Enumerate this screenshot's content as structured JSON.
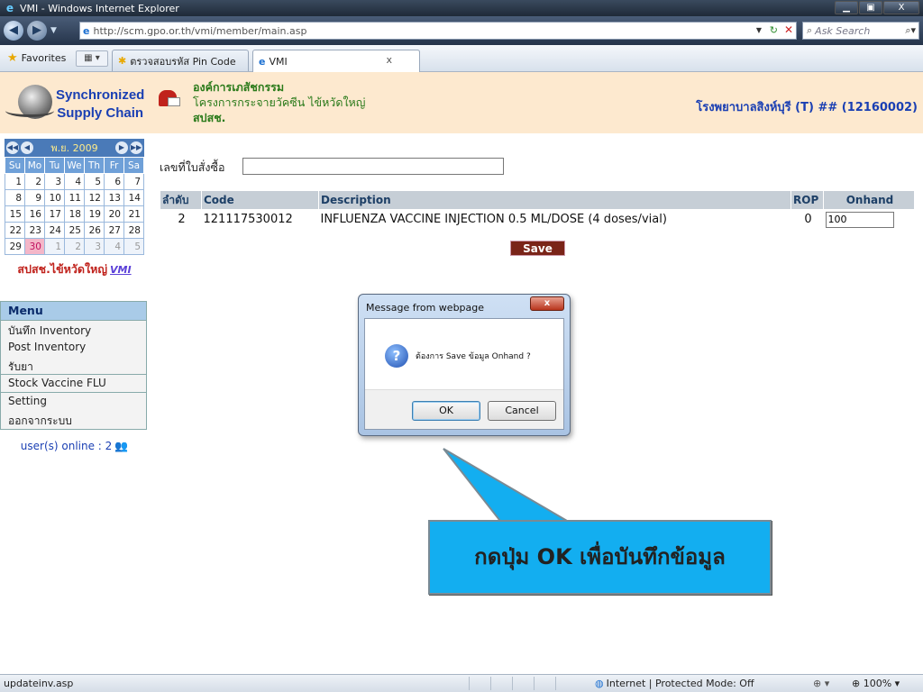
{
  "window": {
    "title": "VMI - Windows Internet Explorer",
    "minimize": "▁",
    "maximize": "▣",
    "close": "X"
  },
  "navbar": {
    "back": "◀",
    "forward": "▶",
    "url": "http://scm.gpo.or.th/vmi/member/main.asp",
    "search_placeholder": "Ask Search"
  },
  "favbar": {
    "favorites_label": "Favorites",
    "tabs": [
      {
        "label": "ตรวจสอบรหัส Pin Code"
      },
      {
        "label": "VMI"
      }
    ]
  },
  "header": {
    "brand_line1": "Synchronized",
    "brand_line2": "Supply Chain",
    "org_line1": "องค์การเภสัชกรรม",
    "org_line2": "โครงการกระจายวัคซีน ไข้หวัดใหญ่",
    "org_line3": "สปสช.",
    "hospital": "โรงพยาบาลสิงห์บุรี (T) ## (12160002)"
  },
  "calendar": {
    "month_label": "พ.ย. 2009",
    "weekdays": [
      "Su",
      "Mo",
      "Tu",
      "We",
      "Th",
      "Fr",
      "Sa"
    ],
    "weeks": [
      [
        1,
        2,
        3,
        4,
        5,
        6,
        7
      ],
      [
        8,
        9,
        10,
        11,
        12,
        13,
        14
      ],
      [
        15,
        16,
        17,
        18,
        19,
        20,
        21
      ],
      [
        22,
        23,
        24,
        25,
        26,
        27,
        28
      ],
      [
        29,
        30,
        1,
        2,
        3,
        4,
        5
      ]
    ],
    "caption": "สปสช.ไข้หวัดใหญ่",
    "caption_logo": "VMI"
  },
  "menu": {
    "title": "Menu",
    "items": [
      {
        "label": "บันทึก Inventory"
      },
      {
        "label": "Post Inventory"
      },
      {
        "label": "รับยา"
      },
      {
        "label": "Stock Vaccine FLU"
      },
      {
        "label": "Setting"
      },
      {
        "label": "ออกจากระบบ"
      }
    ]
  },
  "online": {
    "text": "user(s) online : 2"
  },
  "main": {
    "po_label": "เลขที่ใบสั่งซื้อ",
    "po_value": "",
    "columns": [
      "ลำดับ",
      "Code",
      "Description",
      "ROP",
      "Onhand"
    ],
    "rows": [
      {
        "no": "2",
        "code": "121117530012",
        "description": "INFLUENZA VACCINE INJECTION 0.5 ML/DOSE (4 doses/vial)",
        "rop": "0",
        "onhand": "100"
      }
    ],
    "save_label": "Save"
  },
  "dialog": {
    "title": "Message from webpage",
    "message": "ต้องการ Save ข้อมูล Onhand ?",
    "ok": "OK",
    "cancel": "Cancel"
  },
  "callout": {
    "text": "กดปุ่ม OK เพื่อบันทึกข้อมูล",
    "color": "#13aef0"
  },
  "statusbar": {
    "url": "updateinv.asp",
    "zone": "Internet | Protected Mode: Off",
    "zoom": "100%"
  }
}
